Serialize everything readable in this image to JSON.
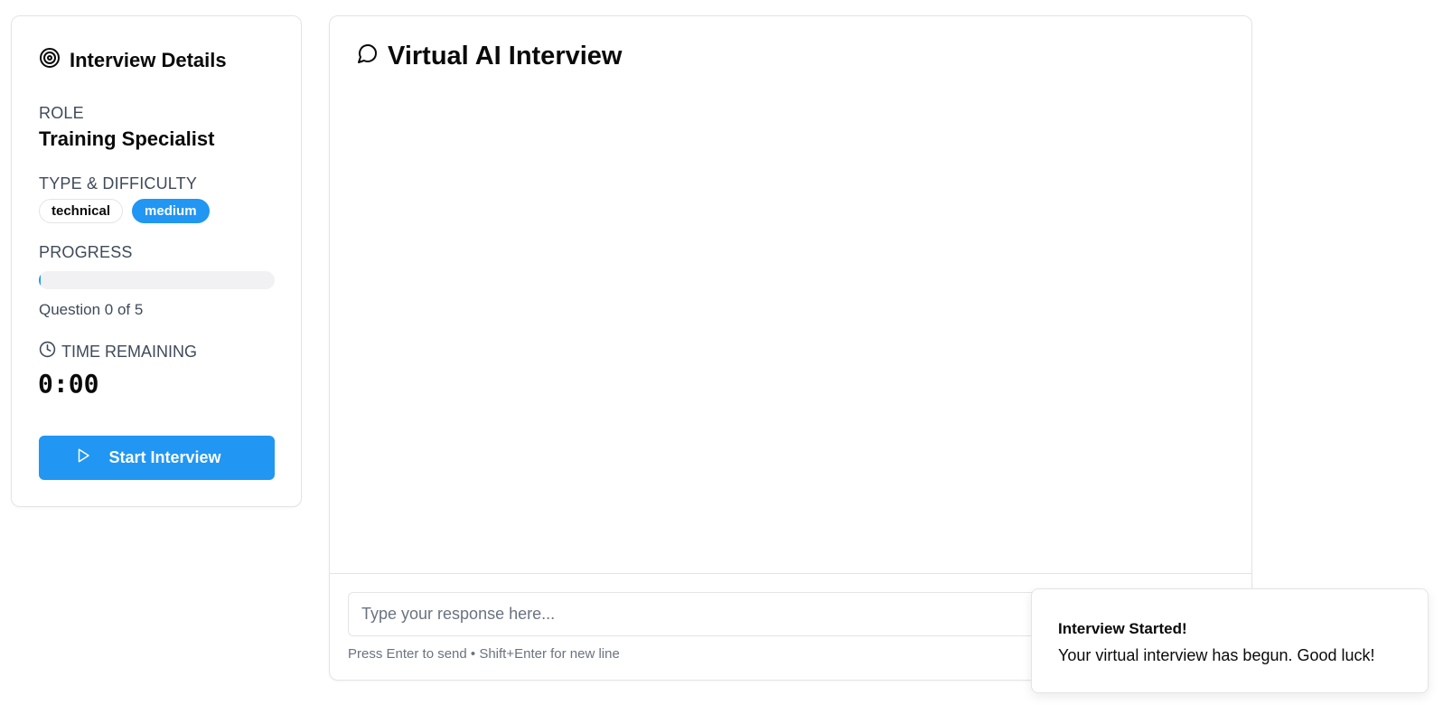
{
  "details": {
    "title": "Interview Details",
    "title_icon": "target-icon",
    "role_label": "ROLE",
    "role_value": "Training Specialist",
    "type_label": "TYPE & DIFFICULTY",
    "type_badge": "technical",
    "difficulty_badge": "medium",
    "progress_label": "PROGRESS",
    "progress_fraction": 0.0,
    "question_count": "Question 0 of 5",
    "time_label": "TIME REMAINING",
    "time_icon": "clock-icon",
    "timer": "0:00",
    "start_button": "Start Interview",
    "start_icon": "play-icon"
  },
  "chat": {
    "title": "Virtual AI Interview",
    "title_icon": "message-circle-icon",
    "input_placeholder": "Type your response here...",
    "input_value": "",
    "hint": "Press Enter to send • Shift+Enter for new line"
  },
  "toast": {
    "title": "Interview Started!",
    "body": "Your virtual interview has begun. Good luck!"
  },
  "colors": {
    "accent": "#2196f3",
    "border": "#e4e4e7",
    "muted_text": "#3f4a5a",
    "track": "#f1f1f3"
  }
}
